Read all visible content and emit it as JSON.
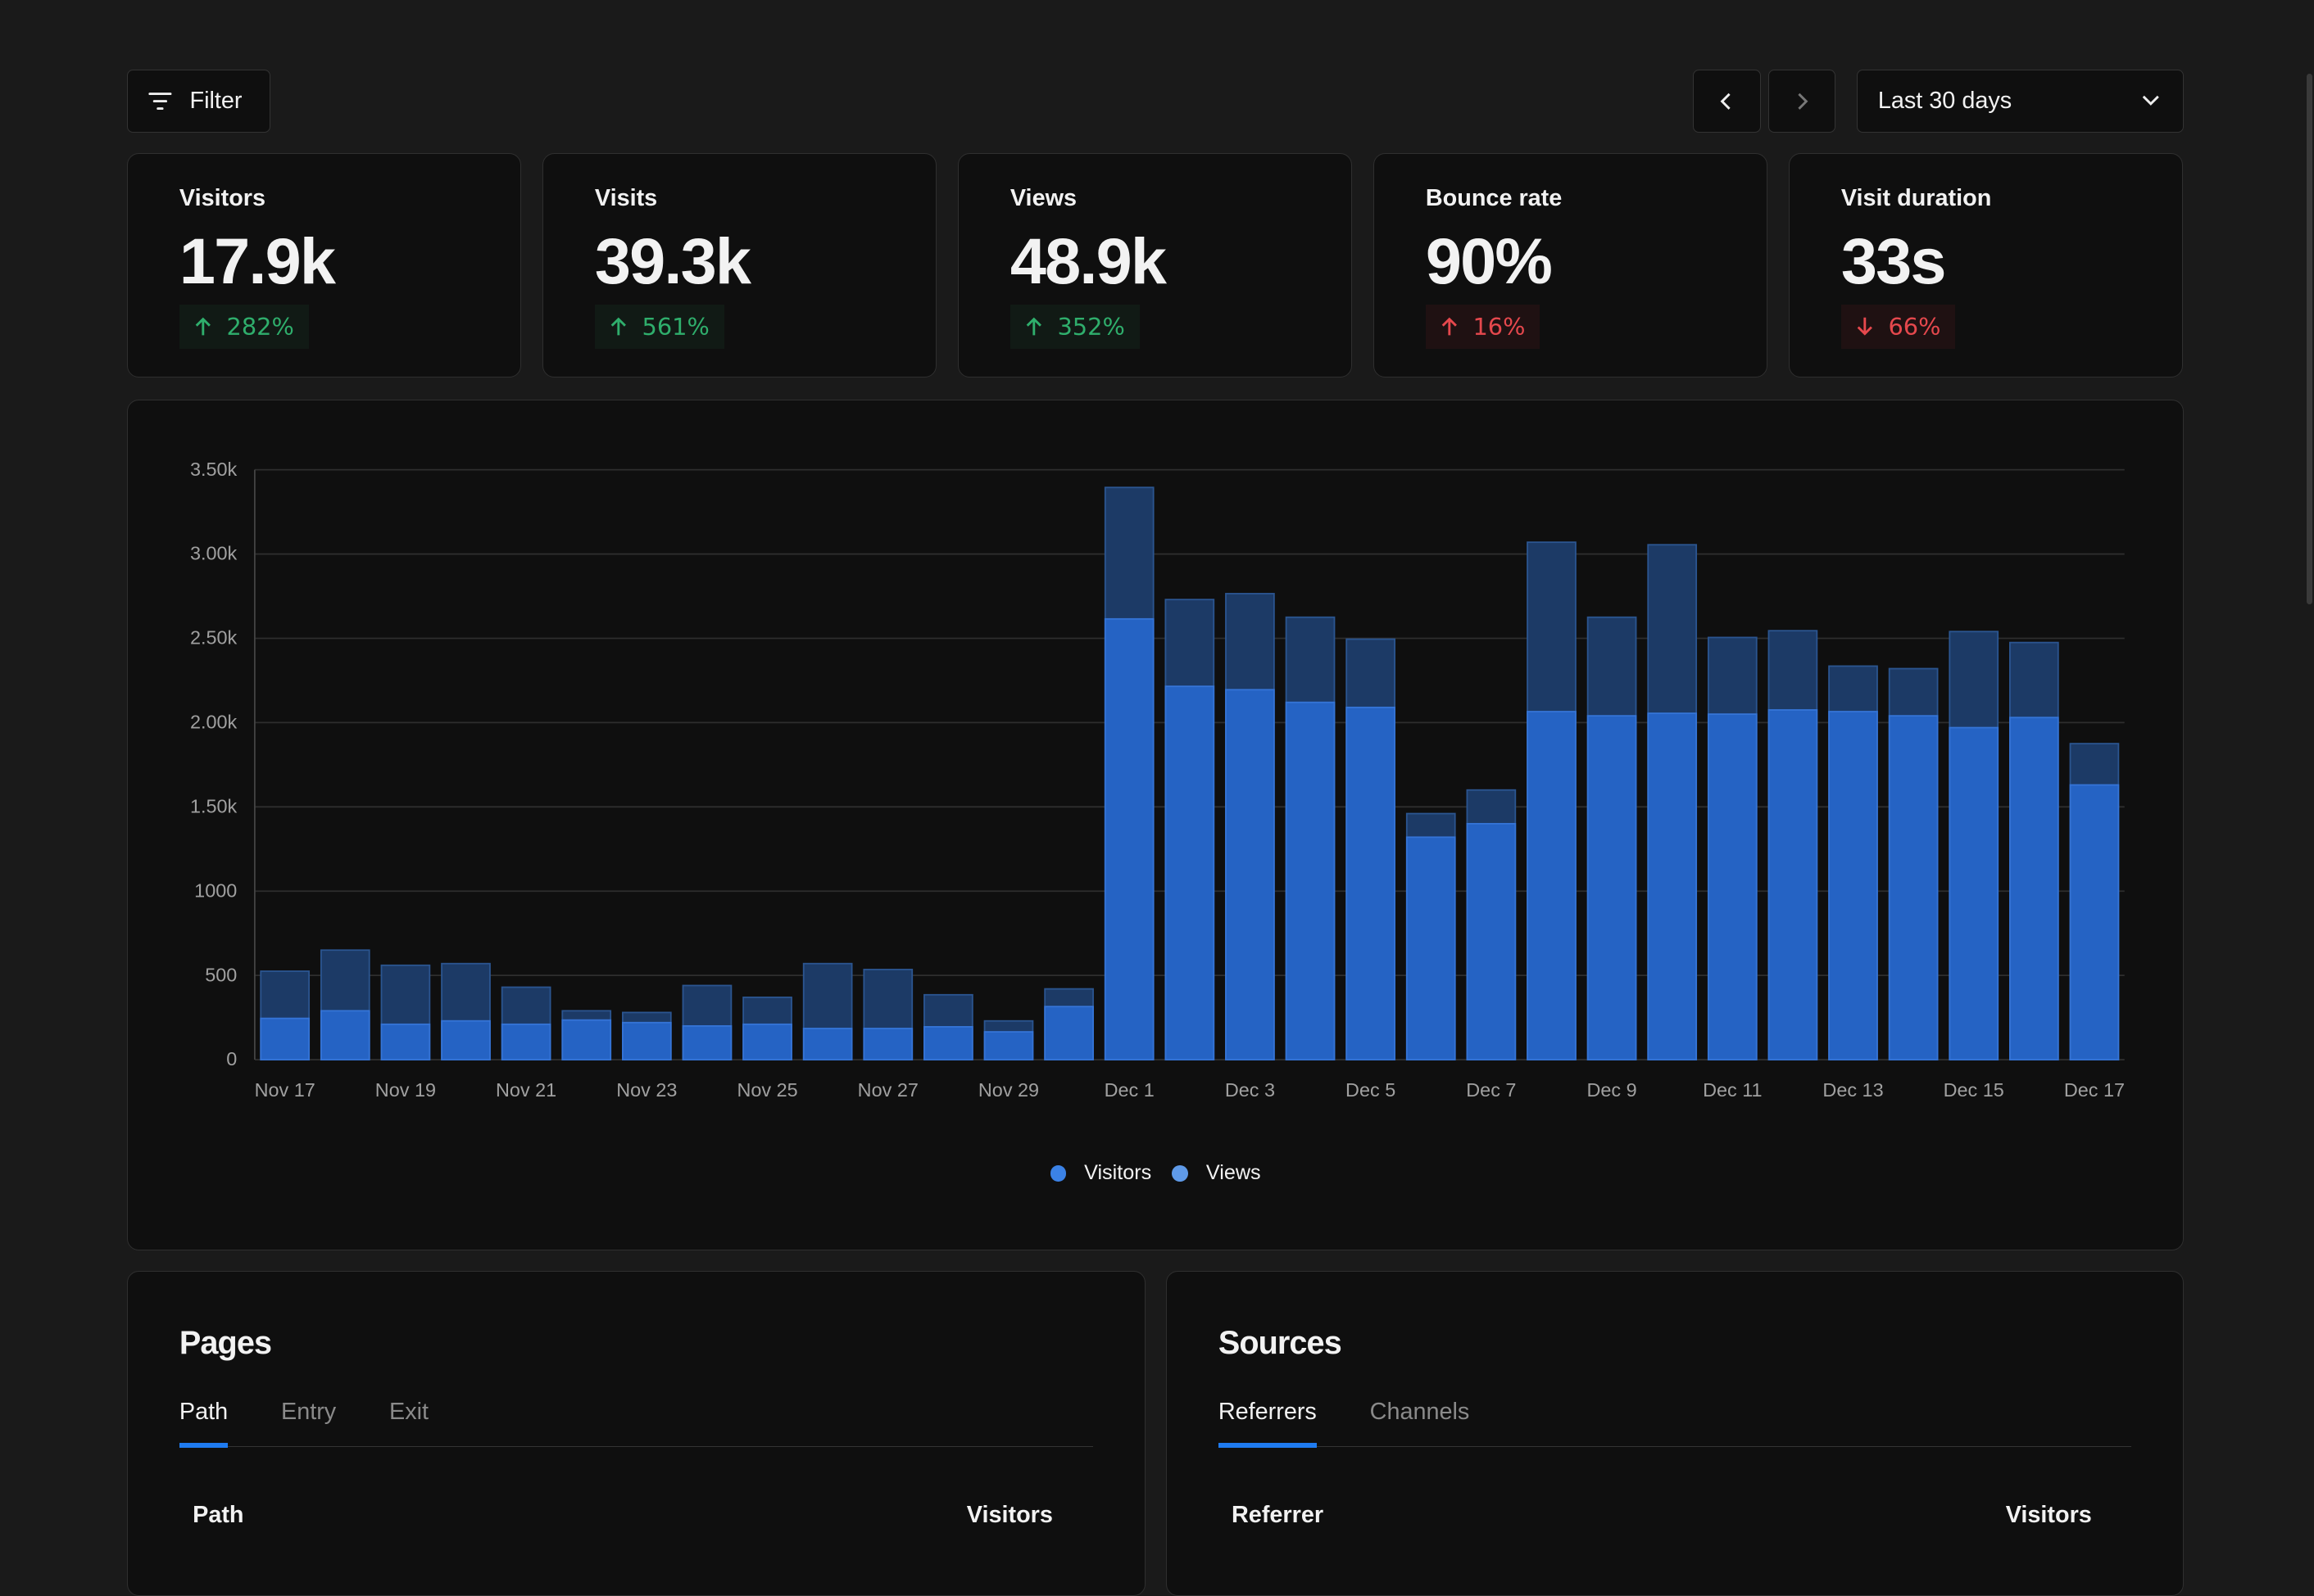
{
  "toolbar": {
    "filter_label": "Filter",
    "prev_icon": "chevron-left",
    "next_icon": "chevron-right",
    "range_label": "Last 30 days"
  },
  "stats": [
    {
      "label": "Visitors",
      "value": "17.9k",
      "change": "282%",
      "direction": "up"
    },
    {
      "label": "Visits",
      "value": "39.3k",
      "change": "561%",
      "direction": "up"
    },
    {
      "label": "Views",
      "value": "48.9k",
      "change": "352%",
      "direction": "up"
    },
    {
      "label": "Bounce rate",
      "value": "90%",
      "change": "16%",
      "direction": "up-bad"
    },
    {
      "label": "Visit duration",
      "value": "33s",
      "change": "66%",
      "direction": "down-bad"
    }
  ],
  "colors": {
    "visitors": "#2563c4",
    "views": "#1c3a66",
    "up": "#2fae6c",
    "down": "#e5484d",
    "accent": "#1f7bf0"
  },
  "chart_data": {
    "type": "bar",
    "stacked_overlay": true,
    "ylim": [
      0,
      3500
    ],
    "yticks": [
      "0",
      "500",
      "1000",
      "1.50k",
      "2.00k",
      "2.50k",
      "3.00k",
      "3.50k"
    ],
    "ytick_values": [
      0,
      500,
      1000,
      1500,
      2000,
      2500,
      3000,
      3500
    ],
    "categories": [
      "Nov 17",
      "Nov 18",
      "Nov 19",
      "Nov 20",
      "Nov 21",
      "Nov 22",
      "Nov 23",
      "Nov 24",
      "Nov 25",
      "Nov 26",
      "Nov 27",
      "Nov 28",
      "Nov 29",
      "Nov 30",
      "Dec 1",
      "Dec 2",
      "Dec 3",
      "Dec 4",
      "Dec 5",
      "Dec 6",
      "Dec 7",
      "Dec 8",
      "Dec 9",
      "Dec 10",
      "Dec 11",
      "Dec 12",
      "Dec 13",
      "Dec 14",
      "Dec 15",
      "Dec 16",
      "Dec 17"
    ],
    "xtick_labels": [
      "Nov 17",
      "Nov 19",
      "Nov 21",
      "Nov 23",
      "Nov 25",
      "Nov 27",
      "Nov 29",
      "Dec 1",
      "Dec 3",
      "Dec 5",
      "Dec 7",
      "Dec 9",
      "Dec 11",
      "Dec 13",
      "Dec 15",
      "Dec 17"
    ],
    "series": [
      {
        "name": "Visitors",
        "values": [
          245,
          290,
          210,
          230,
          210,
          235,
          220,
          200,
          210,
          185,
          185,
          195,
          165,
          315,
          2615,
          2215,
          2195,
          2120,
          2090,
          1320,
          1400,
          2065,
          2040,
          2055,
          2050,
          2075,
          2065,
          2040,
          1970,
          2030,
          1630
        ]
      },
      {
        "name": "Views",
        "values": [
          525,
          650,
          560,
          570,
          430,
          290,
          280,
          440,
          370,
          570,
          535,
          385,
          230,
          420,
          3395,
          2730,
          2765,
          2625,
          2495,
          1460,
          1600,
          3070,
          2625,
          3055,
          2505,
          2545,
          2335,
          2320,
          2540,
          2475,
          1875
        ]
      }
    ],
    "legend": [
      "Visitors",
      "Views"
    ],
    "legend_position": "bottom-center",
    "grid": true
  },
  "pages": {
    "title": "Pages",
    "tabs": [
      "Path",
      "Entry",
      "Exit"
    ],
    "columns": [
      "Path",
      "Visitors"
    ]
  },
  "sources": {
    "title": "Sources",
    "tabs": [
      "Referrers",
      "Channels"
    ],
    "columns": [
      "Referrer",
      "Visitors"
    ]
  }
}
